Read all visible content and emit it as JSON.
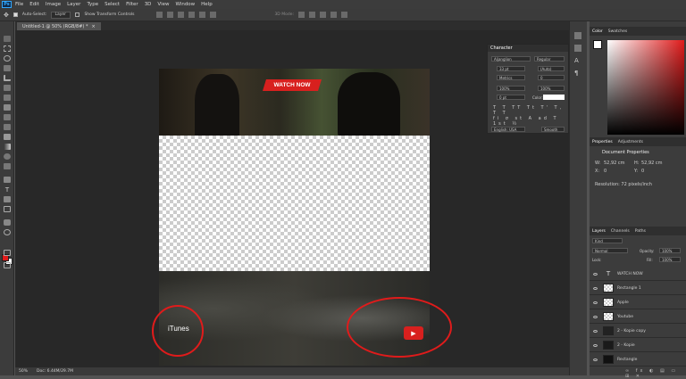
{
  "app": {
    "logo": "Ps"
  },
  "menu": [
    "File",
    "Edit",
    "Image",
    "Layer",
    "Type",
    "Select",
    "Filter",
    "3D",
    "View",
    "Window",
    "Help"
  ],
  "options_bar": {
    "auto_select_label": "Auto-Select:",
    "auto_select_value": "Layer",
    "transform_label": "Show Transform Controls",
    "mode_label": "3D Mode:"
  },
  "document": {
    "tab_title": "Untitled-1 @ 50% (RGB/8#) *",
    "close_glyph": "×",
    "watch_now": "WATCH NOW",
    "itunes_label": "iTunes",
    "apple_glyph": "",
    "youtube_glyph": "▶"
  },
  "status": {
    "zoom": "50%",
    "doc_info": "Doc: 6.44M/29.7M"
  },
  "character_panel": {
    "title": "Character",
    "font_family": "Aljanglion",
    "font_style": "Regular",
    "size": "33 pt",
    "leading": "(Auto)",
    "kerning": "Metrics",
    "tracking": "0",
    "vscale": "100%",
    "hscale": "100%",
    "baseline": "0 pt",
    "color_label": "Color:",
    "language": "English: USA",
    "aa": "Smooth"
  },
  "color_panel": {
    "tabs": [
      "Color",
      "Swatches"
    ],
    "fg_color": "#ffffff",
    "accent": "#e01b1b"
  },
  "properties_panel": {
    "tabs": [
      "Properties",
      "Adjustments"
    ],
    "heading": "Document Properties",
    "w_label": "W:",
    "w_value": "52,92 cm",
    "h_label": "H:",
    "h_value": "52,92 cm",
    "x_label": "X:",
    "x_value": "0",
    "y_label": "Y:",
    "y_value": "0",
    "resolution": "Resolution: 72 pixels/inch"
  },
  "layers_panel": {
    "tabs": [
      "Layers",
      "Channels",
      "Paths"
    ],
    "kind": "Kind",
    "blend": "Normal",
    "opacity_label": "Opacity:",
    "opacity": "100%",
    "lock_label": "Lock:",
    "fill_label": "Fill:",
    "fill": "100%",
    "layers": [
      {
        "name": "WATCH NOW",
        "type": "text"
      },
      {
        "name": "Rectangle 1",
        "type": "raster"
      },
      {
        "name": "Apple",
        "type": "raster"
      },
      {
        "name": "Youtube",
        "type": "raster"
      },
      {
        "name": "2 - Kopie copy",
        "type": "raster"
      },
      {
        "name": "2 - Kopie",
        "type": "raster"
      },
      {
        "name": "Rectangle",
        "type": "raster"
      }
    ]
  }
}
